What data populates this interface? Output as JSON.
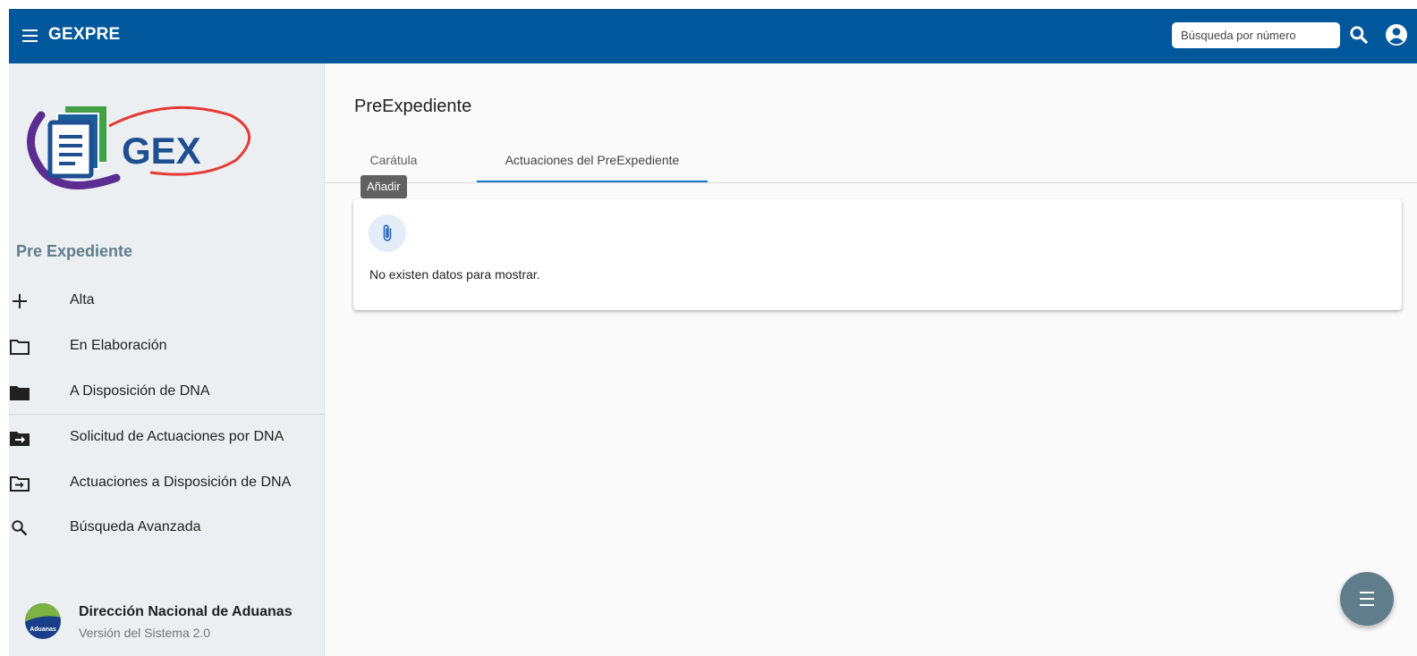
{
  "header": {
    "app_title": "GEXPRE",
    "search_placeholder": "Búsqueda por número",
    "color": "#01579b"
  },
  "sidebar": {
    "logo_text": "GEX",
    "section_title": "Pre Expediente",
    "items": [
      {
        "label": "Alta",
        "icon": "plus-icon"
      },
      {
        "label": "En Elaboración",
        "icon": "folder-outline-icon"
      },
      {
        "label": "A Disposición de DNA",
        "icon": "folder-icon"
      },
      {
        "label": "Solicitud de Actuaciones por DNA",
        "icon": "folder-arrow-icon"
      },
      {
        "label": "Actuaciones a Disposición de DNA",
        "icon": "folder-arrow-outline-icon"
      },
      {
        "label": "Búsqueda Avanzada",
        "icon": "search-icon"
      }
    ],
    "footer": {
      "logo_text": "Aduanas",
      "org_name": "Dirección Nacional de Aduanas",
      "version": "Versión del Sistema 2.0"
    }
  },
  "main": {
    "title": "PreExpediente",
    "tabs": [
      {
        "label": "Carátula",
        "active": false
      },
      {
        "label": "Actuaciones del PreExpediente",
        "active": true
      }
    ],
    "tooltip": "Añadir",
    "empty_message": "No existen datos para mostrar."
  },
  "colors": {
    "accent": "#1976d2",
    "fab": "#607d8b",
    "section_title": "#607d8b"
  }
}
